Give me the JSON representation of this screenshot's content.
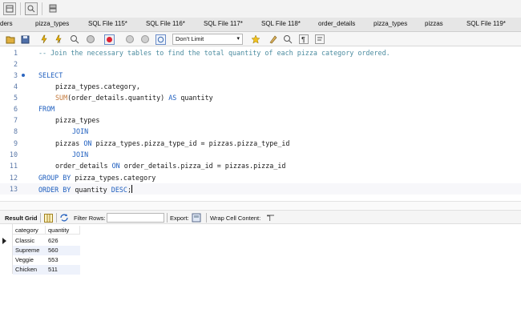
{
  "tabs": [
    "ders",
    "pizza_types",
    "SQL File 115*",
    "SQL File 116*",
    "SQL File 117*",
    "SQL File 118*",
    "order_details",
    "pizza_types",
    "pizzas",
    "SQL File 119*"
  ],
  "editor_toolbar": {
    "limit_label": "Don't Limit"
  },
  "editor": {
    "line_numbers": [
      "1",
      "2",
      "3",
      "4",
      "5",
      "6",
      "7",
      "8",
      "9",
      "10",
      "11",
      "12",
      "13"
    ],
    "comment": "-- Join the necessary tables to find the total quantity of each pizza category ordered.",
    "select_kw": "SELECT",
    "line4": "pizza_types.category,",
    "line5_fn": "SUM",
    "line5_rest": "(order_details.quantity)",
    "as_kw": "AS",
    "line5_alias": "quantity",
    "from_kw": "FROM",
    "line7": "pizza_types",
    "join_kw": "JOIN",
    "line9_a": "pizzas",
    "on_kw": "ON",
    "line9_b": "pizza_types.pizza_type_id = pizzas.pizza_type_id",
    "line11_a": "order_details",
    "line11_b": "order_details.pizza_id = pizzas.pizza_id",
    "groupby_kw": "GROUP BY",
    "line12": "pizza_types.category",
    "orderby_kw": "ORDER BY",
    "line13": "quantity",
    "desc_kw": "DESC",
    "line13_end": ";"
  },
  "result_toolbar": {
    "result_grid_label": "Result Grid",
    "filter_label": "Filter Rows:",
    "export_label": "Export:",
    "wrap_label": "Wrap Cell Content:"
  },
  "result_grid": {
    "columns": [
      "category",
      "quantity"
    ],
    "rows": [
      [
        "Classic",
        "626"
      ],
      [
        "Supreme",
        "560"
      ],
      [
        "Veggie",
        "553"
      ],
      [
        "Chicken",
        "511"
      ]
    ]
  },
  "colors": {
    "keyword": "#1f5fbf",
    "function": "#c47a3c",
    "comment": "#4c8ca0",
    "alt_row": "#eef2fb"
  }
}
